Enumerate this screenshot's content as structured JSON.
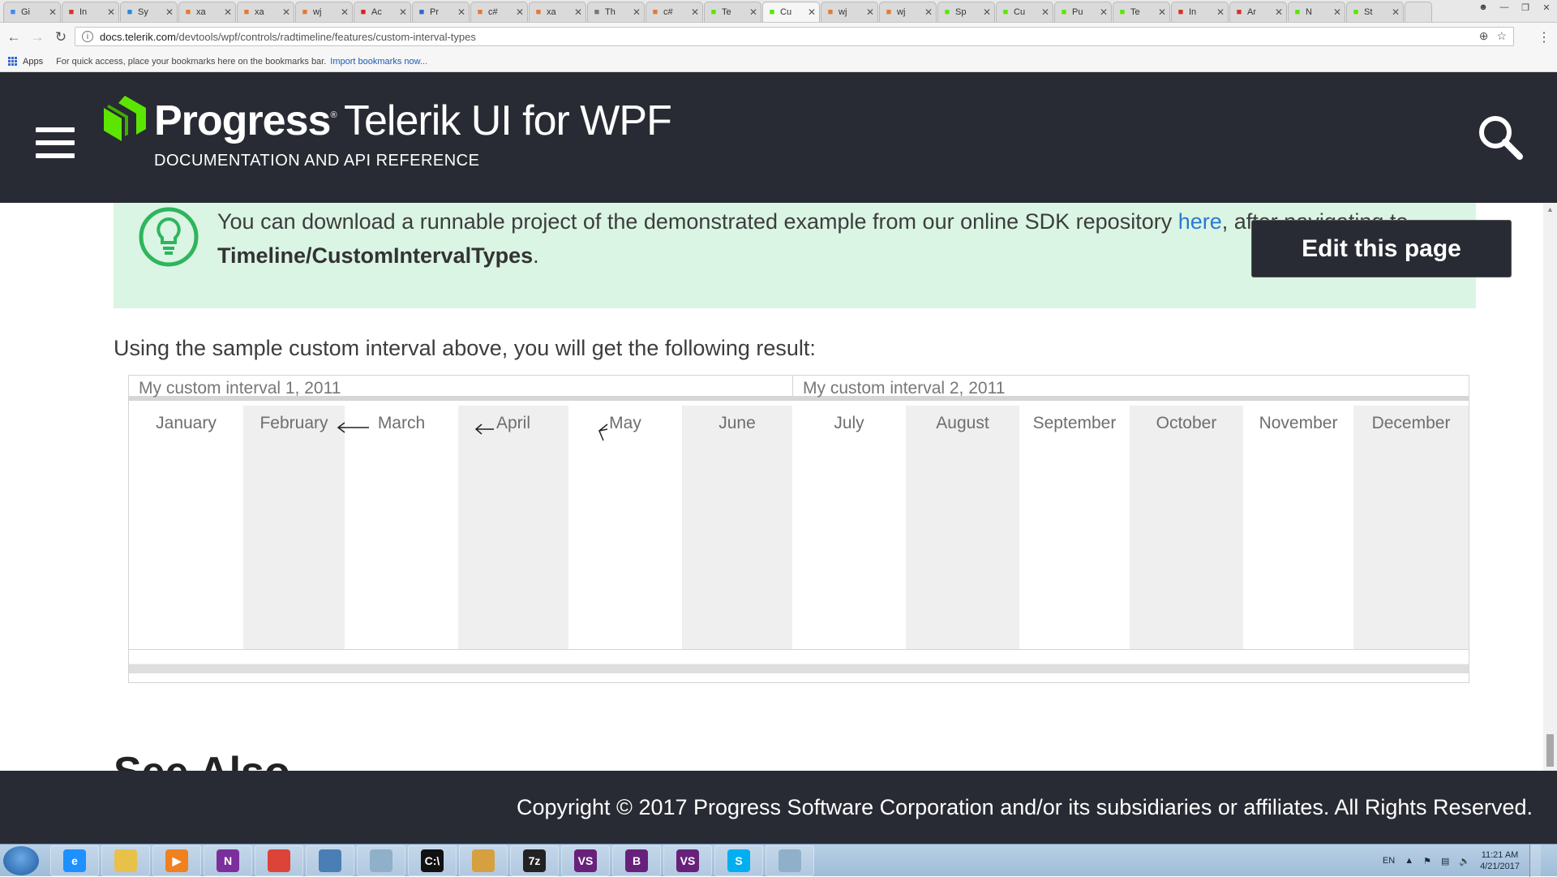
{
  "browser": {
    "tabs": [
      {
        "label": "Gi",
        "icon": "google-icon",
        "color": "#4285f4"
      },
      {
        "label": "In",
        "icon": "gmail-icon",
        "color": "#d93025"
      },
      {
        "label": "Sy",
        "icon": "account-icon",
        "color": "#2b88d8"
      },
      {
        "label": "xa",
        "icon": "xamarin-icon",
        "color": "#e07b39"
      },
      {
        "label": "xa",
        "icon": "xamarin-icon",
        "color": "#e07b39"
      },
      {
        "label": "wj",
        "icon": "stackoverflow-icon",
        "color": "#e07b39"
      },
      {
        "label": "Ac",
        "icon": "adobe-icon",
        "color": "#d91f26"
      },
      {
        "label": "Pr",
        "icon": "tool-icon",
        "color": "#3064c8"
      },
      {
        "label": "c#",
        "icon": "stackoverflow-icon",
        "color": "#e07b39"
      },
      {
        "label": "xa",
        "icon": "xamarin-icon",
        "color": "#e07b39"
      },
      {
        "label": "Th",
        "icon": "page-icon",
        "color": "#777777"
      },
      {
        "label": "c#",
        "icon": "stackoverflow-icon",
        "color": "#e07b39"
      },
      {
        "label": "Te",
        "icon": "telerik-icon",
        "color": "#5ce500"
      },
      {
        "label": "Cu",
        "icon": "telerik-icon",
        "color": "#5ce500",
        "active": true
      },
      {
        "label": "wj",
        "icon": "stackoverflow-icon",
        "color": "#e07b39"
      },
      {
        "label": "wj",
        "icon": "stackoverflow-icon",
        "color": "#e07b39"
      },
      {
        "label": "Sp",
        "icon": "telerik-icon",
        "color": "#5ce500"
      },
      {
        "label": "Cu",
        "icon": "telerik-icon",
        "color": "#5ce500"
      },
      {
        "label": "Pu",
        "icon": "telerik-icon",
        "color": "#5ce500"
      },
      {
        "label": "Te",
        "icon": "telerik-icon",
        "color": "#5ce500"
      },
      {
        "label": "In",
        "icon": "gmail-icon",
        "color": "#d93025"
      },
      {
        "label": "Ar",
        "icon": "gmail-icon",
        "color": "#d93025"
      },
      {
        "label": "N",
        "icon": "telerik-icon",
        "color": "#5ce500"
      },
      {
        "label": "St",
        "icon": "telerik-icon",
        "color": "#5ce500"
      }
    ],
    "url_host": "docs.telerik.com",
    "url_path": "/devtools/wpf/controls/radtimeline/features/custom-interval-types",
    "bookmarks": {
      "apps_label": "Apps",
      "hint": "For quick access, place your bookmarks here on the bookmarks bar.",
      "import_link": "Import bookmarks now..."
    }
  },
  "header": {
    "brand_progress": "Progress",
    "brand_product": "Telerik UI for WPF",
    "subtitle": "DOCUMENTATION AND API REFERENCE",
    "brand_color": "#5ce500"
  },
  "tip": {
    "text_before": "You can download a runnable project of the demonstrated example from our online SDK repository ",
    "link": "here",
    "text_after": ", after navigating to ",
    "path": "Timeline/CustomIntervalTypes",
    "end": "."
  },
  "edit_button": "Edit this page",
  "result_text": "Using the sample custom interval above, you will get the following result:",
  "timeline": {
    "groups": [
      "My custom interval 1, 2011",
      "My custom interval 2, 2011"
    ],
    "months": [
      "January",
      "February",
      "March",
      "April",
      "May",
      "June",
      "July",
      "August",
      "September",
      "October",
      "November",
      "December"
    ]
  },
  "see_also": "See Also",
  "footer": {
    "copyright": "Copyright © 2017 Progress Software Corporation and/or its subsidiaries or affiliates. All Rights Reserved."
  },
  "taskbar": {
    "apps": [
      {
        "name": "internet-explorer-icon",
        "label": "e",
        "color": "#1e90ff"
      },
      {
        "name": "file-explorer-icon",
        "label": "",
        "color": "#e8c14a"
      },
      {
        "name": "media-player-icon",
        "label": "▶",
        "color": "#f08020"
      },
      {
        "name": "onenote-icon",
        "label": "N",
        "color": "#7b2f9c"
      },
      {
        "name": "chrome-icon",
        "label": "",
        "color": "#db4437"
      },
      {
        "name": "remote-desktop-icon",
        "label": "",
        "color": "#4a7fb5"
      },
      {
        "name": "notepad-icon",
        "label": "",
        "color": "#8fb0c8"
      },
      {
        "name": "cmd-icon",
        "label": "C:\\",
        "color": "#111111"
      },
      {
        "name": "paint-icon",
        "label": "",
        "color": "#d6a040"
      },
      {
        "name": "7zip-icon",
        "label": "7z",
        "color": "#222222"
      },
      {
        "name": "visual-studio-icon",
        "label": "VS",
        "color": "#68217a"
      },
      {
        "name": "blend-icon",
        "label": "B",
        "color": "#68217a"
      },
      {
        "name": "visual-studio-2-icon",
        "label": "VS",
        "color": "#68217a"
      },
      {
        "name": "skype-icon",
        "label": "S",
        "color": "#00aff0"
      },
      {
        "name": "notepad-2-icon",
        "label": "",
        "color": "#8fb0c8"
      }
    ],
    "lang": "EN",
    "time": "11:21 AM",
    "date": "4/21/2017"
  }
}
